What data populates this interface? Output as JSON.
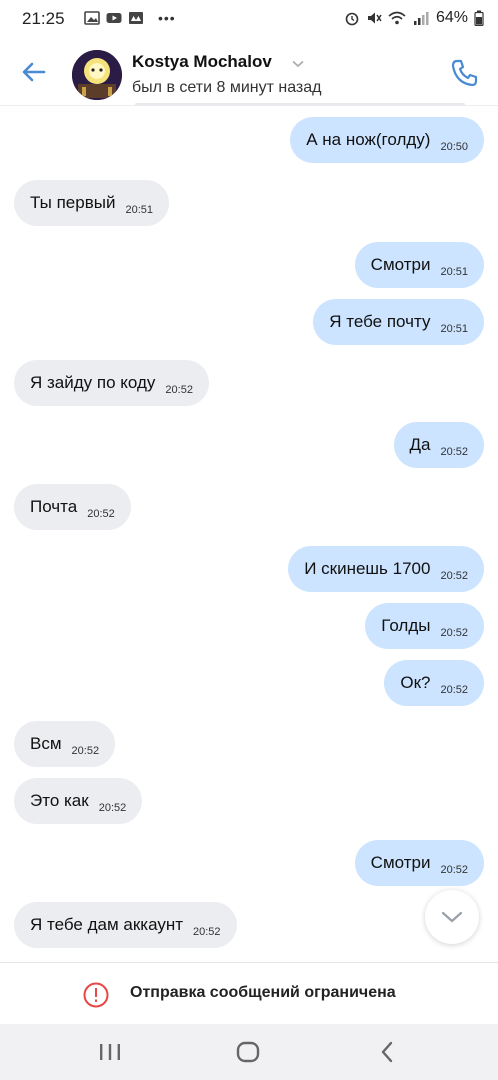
{
  "status_bar": {
    "time": "21:25",
    "battery": "64%",
    "left_icons": [
      "image-icon",
      "youtube-icon",
      "gallery-icon"
    ],
    "right_icons": [
      "alarm-icon",
      "mute-icon",
      "wifi-icon",
      "signal-icon",
      "battery-icon"
    ]
  },
  "header": {
    "name": "Kostya Mochalov",
    "status": "был в сети 8 минут назад",
    "accent": "#4a8ad4"
  },
  "messages": [
    {
      "dir": "out",
      "text": "А на нож(голду)",
      "time": "20:50"
    },
    {
      "dir": "in",
      "text": "Ты первый",
      "time": "20:51"
    },
    {
      "dir": "out",
      "text": "Смотри",
      "time": "20:51"
    },
    {
      "dir": "out",
      "text": "Я тебе почту",
      "time": "20:51"
    },
    {
      "dir": "in",
      "text": "Я зайду по коду",
      "time": "20:52"
    },
    {
      "dir": "out",
      "text": "Да",
      "time": "20:52"
    },
    {
      "dir": "in",
      "text": "Почта",
      "time": "20:52"
    },
    {
      "dir": "out",
      "text": "И скинешь 1700",
      "time": "20:52"
    },
    {
      "dir": "out",
      "text": "Голды",
      "time": "20:52"
    },
    {
      "dir": "out",
      "text": "Ок?",
      "time": "20:52"
    },
    {
      "dir": "in",
      "text": "Всм",
      "time": "20:52"
    },
    {
      "dir": "in",
      "text": "Это как",
      "time": "20:52"
    },
    {
      "dir": "out",
      "text": "Смотри",
      "time": "20:52"
    },
    {
      "dir": "in",
      "text": "Я тебе дам аккаунт",
      "time": "20:52"
    }
  ],
  "restricted": {
    "text": "Отправка сообщений ограничена",
    "color": "#e64646"
  },
  "colors": {
    "incoming_bubble": "#ebedf0",
    "outgoing_bubble": "#cce4ff"
  }
}
